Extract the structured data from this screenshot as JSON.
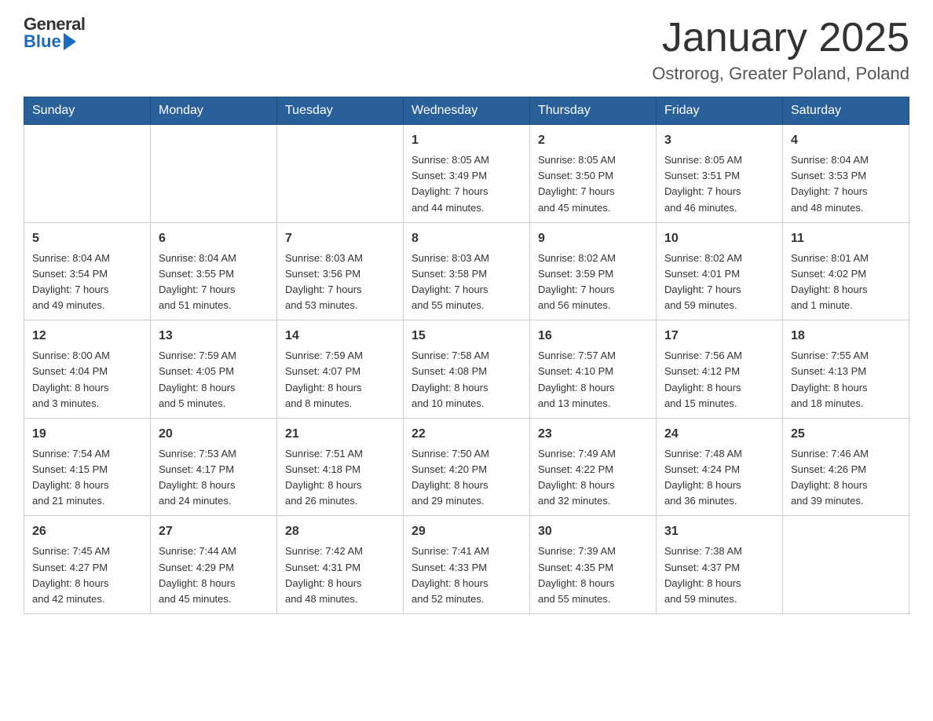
{
  "header": {
    "month_year": "January 2025",
    "location": "Ostrorog, Greater Poland, Poland",
    "logo_general": "General",
    "logo_blue": "Blue"
  },
  "weekdays": [
    "Sunday",
    "Monday",
    "Tuesday",
    "Wednesday",
    "Thursday",
    "Friday",
    "Saturday"
  ],
  "weeks": [
    [
      {
        "day": "",
        "info": ""
      },
      {
        "day": "",
        "info": ""
      },
      {
        "day": "",
        "info": ""
      },
      {
        "day": "1",
        "info": "Sunrise: 8:05 AM\nSunset: 3:49 PM\nDaylight: 7 hours\nand 44 minutes."
      },
      {
        "day": "2",
        "info": "Sunrise: 8:05 AM\nSunset: 3:50 PM\nDaylight: 7 hours\nand 45 minutes."
      },
      {
        "day": "3",
        "info": "Sunrise: 8:05 AM\nSunset: 3:51 PM\nDaylight: 7 hours\nand 46 minutes."
      },
      {
        "day": "4",
        "info": "Sunrise: 8:04 AM\nSunset: 3:53 PM\nDaylight: 7 hours\nand 48 minutes."
      }
    ],
    [
      {
        "day": "5",
        "info": "Sunrise: 8:04 AM\nSunset: 3:54 PM\nDaylight: 7 hours\nand 49 minutes."
      },
      {
        "day": "6",
        "info": "Sunrise: 8:04 AM\nSunset: 3:55 PM\nDaylight: 7 hours\nand 51 minutes."
      },
      {
        "day": "7",
        "info": "Sunrise: 8:03 AM\nSunset: 3:56 PM\nDaylight: 7 hours\nand 53 minutes."
      },
      {
        "day": "8",
        "info": "Sunrise: 8:03 AM\nSunset: 3:58 PM\nDaylight: 7 hours\nand 55 minutes."
      },
      {
        "day": "9",
        "info": "Sunrise: 8:02 AM\nSunset: 3:59 PM\nDaylight: 7 hours\nand 56 minutes."
      },
      {
        "day": "10",
        "info": "Sunrise: 8:02 AM\nSunset: 4:01 PM\nDaylight: 7 hours\nand 59 minutes."
      },
      {
        "day": "11",
        "info": "Sunrise: 8:01 AM\nSunset: 4:02 PM\nDaylight: 8 hours\nand 1 minute."
      }
    ],
    [
      {
        "day": "12",
        "info": "Sunrise: 8:00 AM\nSunset: 4:04 PM\nDaylight: 8 hours\nand 3 minutes."
      },
      {
        "day": "13",
        "info": "Sunrise: 7:59 AM\nSunset: 4:05 PM\nDaylight: 8 hours\nand 5 minutes."
      },
      {
        "day": "14",
        "info": "Sunrise: 7:59 AM\nSunset: 4:07 PM\nDaylight: 8 hours\nand 8 minutes."
      },
      {
        "day": "15",
        "info": "Sunrise: 7:58 AM\nSunset: 4:08 PM\nDaylight: 8 hours\nand 10 minutes."
      },
      {
        "day": "16",
        "info": "Sunrise: 7:57 AM\nSunset: 4:10 PM\nDaylight: 8 hours\nand 13 minutes."
      },
      {
        "day": "17",
        "info": "Sunrise: 7:56 AM\nSunset: 4:12 PM\nDaylight: 8 hours\nand 15 minutes."
      },
      {
        "day": "18",
        "info": "Sunrise: 7:55 AM\nSunset: 4:13 PM\nDaylight: 8 hours\nand 18 minutes."
      }
    ],
    [
      {
        "day": "19",
        "info": "Sunrise: 7:54 AM\nSunset: 4:15 PM\nDaylight: 8 hours\nand 21 minutes."
      },
      {
        "day": "20",
        "info": "Sunrise: 7:53 AM\nSunset: 4:17 PM\nDaylight: 8 hours\nand 24 minutes."
      },
      {
        "day": "21",
        "info": "Sunrise: 7:51 AM\nSunset: 4:18 PM\nDaylight: 8 hours\nand 26 minutes."
      },
      {
        "day": "22",
        "info": "Sunrise: 7:50 AM\nSunset: 4:20 PM\nDaylight: 8 hours\nand 29 minutes."
      },
      {
        "day": "23",
        "info": "Sunrise: 7:49 AM\nSunset: 4:22 PM\nDaylight: 8 hours\nand 32 minutes."
      },
      {
        "day": "24",
        "info": "Sunrise: 7:48 AM\nSunset: 4:24 PM\nDaylight: 8 hours\nand 36 minutes."
      },
      {
        "day": "25",
        "info": "Sunrise: 7:46 AM\nSunset: 4:26 PM\nDaylight: 8 hours\nand 39 minutes."
      }
    ],
    [
      {
        "day": "26",
        "info": "Sunrise: 7:45 AM\nSunset: 4:27 PM\nDaylight: 8 hours\nand 42 minutes."
      },
      {
        "day": "27",
        "info": "Sunrise: 7:44 AM\nSunset: 4:29 PM\nDaylight: 8 hours\nand 45 minutes."
      },
      {
        "day": "28",
        "info": "Sunrise: 7:42 AM\nSunset: 4:31 PM\nDaylight: 8 hours\nand 48 minutes."
      },
      {
        "day": "29",
        "info": "Sunrise: 7:41 AM\nSunset: 4:33 PM\nDaylight: 8 hours\nand 52 minutes."
      },
      {
        "day": "30",
        "info": "Sunrise: 7:39 AM\nSunset: 4:35 PM\nDaylight: 8 hours\nand 55 minutes."
      },
      {
        "day": "31",
        "info": "Sunrise: 7:38 AM\nSunset: 4:37 PM\nDaylight: 8 hours\nand 59 minutes."
      },
      {
        "day": "",
        "info": ""
      }
    ]
  ]
}
